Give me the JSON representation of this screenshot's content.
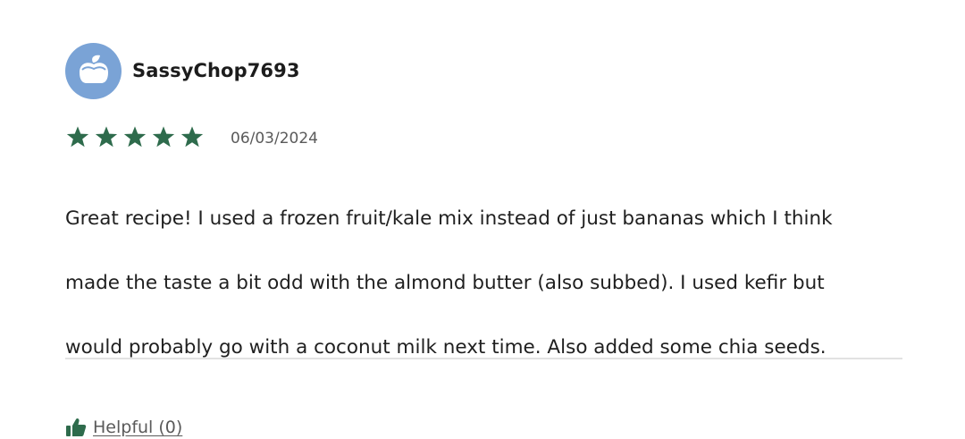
{
  "review": {
    "username": "SassyChop7693",
    "avatar_icon": "apple-icon",
    "avatar_color": "#7aa3d6",
    "rating": 5,
    "rating_max": 5,
    "star_color": "#2e6b4c",
    "date": "06/03/2024",
    "text_lines": [
      "Great recipe! I used a frozen fruit/kale mix instead of just bananas which I think",
      "made the taste a bit odd with the almond butter (also subbed). I used kefir but",
      "would probably go with a coconut milk next time. Also added some chia seeds."
    ],
    "helpful_icon": "thumbs-up-icon",
    "helpful_label": "Helpful (0)"
  }
}
